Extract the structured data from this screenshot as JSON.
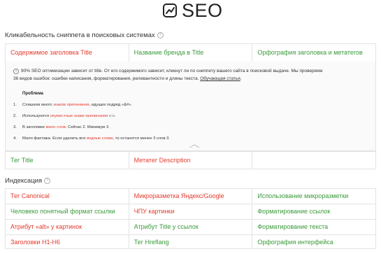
{
  "header": {
    "title": "SEO",
    "icon": "chart-trend-icon"
  },
  "snippet": {
    "title": "Кликабельность сниппета в поисковых системах",
    "help": "?",
    "top_row": [
      {
        "label": "Содержимое заголовка Title",
        "status": "red"
      },
      {
        "label": "Название бренда в Title",
        "status": "green"
      },
      {
        "label": "Орфография заголовка и метатегов",
        "status": "green"
      }
    ],
    "info": {
      "icon": "i",
      "line1": "90% SEO оптимизации зависит от title. От его содержимого зависит, кликнут ли по сниппету вашего сайта в поисковой выдаче. Мы проверяем",
      "line2_text": "36 видов ошибок: ошибки написания, форматирования, релевантности и длины текста.",
      "line2_link": "Обучающая статья",
      "problem_title": "Проблема",
      "problems": [
        {
          "num": "1.",
          "before": "Слишком много ",
          "highlight": "знаков препинания",
          "after": ", идущих подряд «&#»."
        },
        {
          "num": "2.",
          "before": "Используются ",
          "highlight": "неуместные знаки препинания",
          "after": " «:»."
        },
        {
          "num": "3.",
          "before": "В заголовке ",
          "highlight": "мало слов",
          "after": ". Сейчас 2. Минимум 3."
        },
        {
          "num": "4.",
          "before": "Мало фактажа. Если удалить все ",
          "highlight": "водные слова",
          "after": ", то останется менее 3 слов 3."
        }
      ]
    },
    "bottom_row": [
      {
        "label": "Тег Title",
        "status": "green"
      },
      {
        "label": "Метатег Description",
        "status": "red"
      },
      {
        "label": "",
        "status": "none"
      }
    ]
  },
  "indexing": {
    "title": "Индексация",
    "help": "?",
    "rows": [
      [
        {
          "label": "Тег Canonical",
          "status": "red"
        },
        {
          "label": "Микроразметка Яндекс/Google",
          "status": "red"
        },
        {
          "label": "Использование микроразметки",
          "status": "green"
        }
      ],
      [
        {
          "label": "Человеко понятный формат ссылки",
          "status": "green"
        },
        {
          "label": "ЧПУ картинки",
          "status": "red"
        },
        {
          "label": "Форматирование ссылок",
          "status": "green"
        }
      ],
      [
        {
          "label": "Атрибут «alt» у картинок",
          "status": "red"
        },
        {
          "label": "Атрибут Title у ссылок",
          "status": "green"
        },
        {
          "label": "Форматирование текста",
          "status": "green"
        }
      ],
      [
        {
          "label": "Заголовки H1-H6",
          "status": "red"
        },
        {
          "label": "Тег Hreflang",
          "status": "green"
        },
        {
          "label": "Орфография интерфейса",
          "status": "green"
        }
      ]
    ]
  },
  "colors": {
    "error": "#e23b2e",
    "ok": "#3a9a3a",
    "border": "#e3e3e3"
  }
}
